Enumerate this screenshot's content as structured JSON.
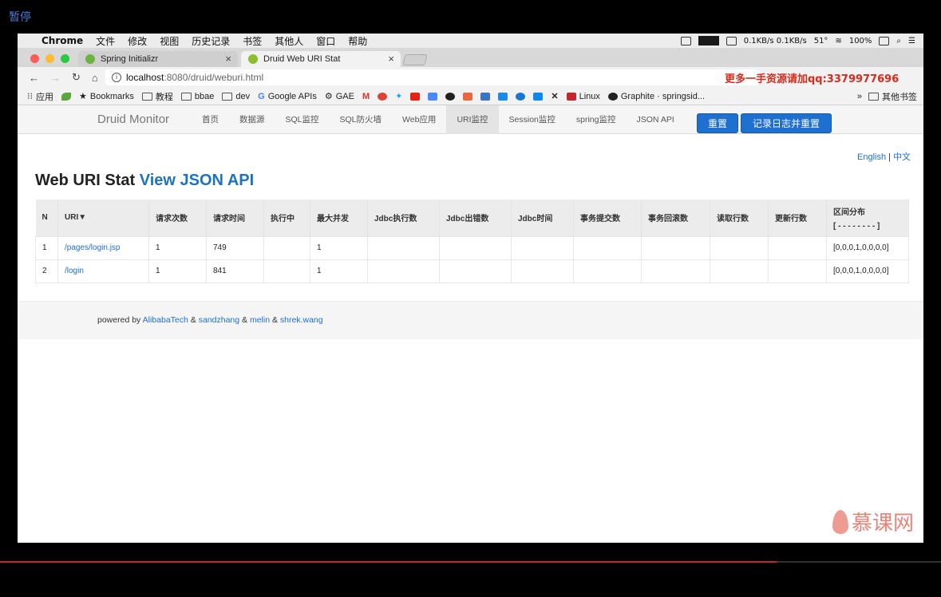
{
  "overlay": {
    "pause_label": "暂停",
    "progress": 0.825
  },
  "menubar": {
    "apple": "",
    "items": [
      "Chrome",
      "文件",
      "修改",
      "视图",
      "历史记录",
      "书签",
      "其他人",
      "窗口",
      "帮助"
    ],
    "net": "0.1KB/s 0.1KB/s",
    "temp": "51°",
    "battery": "100%"
  },
  "tabs": [
    {
      "label": "Spring Initializr",
      "favicon_color": "#6db33f"
    },
    {
      "label": "Druid Web URI Stat",
      "favicon_color": "#8bbf2f"
    }
  ],
  "toolbar": {
    "url_host": "localhost",
    "url_path": ":8080/druid/weburi.html",
    "watermark": "更多一手资源请加qq:3379977696"
  },
  "bookmarks": {
    "items": [
      "应用",
      "Bookmarks",
      "教程",
      "bbae",
      "dev",
      "Google APIs",
      "GAE",
      "Linux",
      "Graphite · springsid..."
    ],
    "other": "其他书签"
  },
  "page": {
    "brand": "Druid Monitor",
    "nav": [
      "首页",
      "数据源",
      "SQL监控",
      "SQL防火墙",
      "Web应用",
      "URI监控",
      "Session监控",
      "spring监控",
      "JSON API"
    ],
    "active_nav": "URI监控",
    "btn_reset": "重置",
    "btn_log_reset": "记录日志并重置",
    "lang_en": "English",
    "lang_sep": "|",
    "lang_zh": "中文",
    "title": "Web URI Stat",
    "title_link": "View JSON API",
    "table": {
      "headers": [
        "N",
        "URI▼",
        "请求次数",
        "请求时间",
        "执行中",
        "最大并发",
        "Jdbc执行数",
        "Jdbc出错数",
        "Jdbc时间",
        "事务提交数",
        "事务回滚数",
        "读取行数",
        "更新行数",
        "区间分布"
      ],
      "range_header_sub": "[ - - - - - - - - ]",
      "rows": [
        [
          "1",
          "/pages/login.jsp",
          "1",
          "749",
          "",
          "1",
          "",
          "",
          "",
          "",
          "",
          "",
          "",
          "[0,0,0,1,0,0,0,0]"
        ],
        [
          "2",
          "/login",
          "1",
          "841",
          "",
          "1",
          "",
          "",
          "",
          "",
          "",
          "",
          "",
          "[0,0,0,1,0,0,0,0]"
        ]
      ]
    },
    "footer": {
      "powered_by": "powered by",
      "alibaba": "AlibabaTech",
      "amp": "&",
      "sandzhang": "sandzhang",
      "melin": "melin",
      "shrek": "shrek.wang"
    },
    "logo_text": "慕课网"
  }
}
